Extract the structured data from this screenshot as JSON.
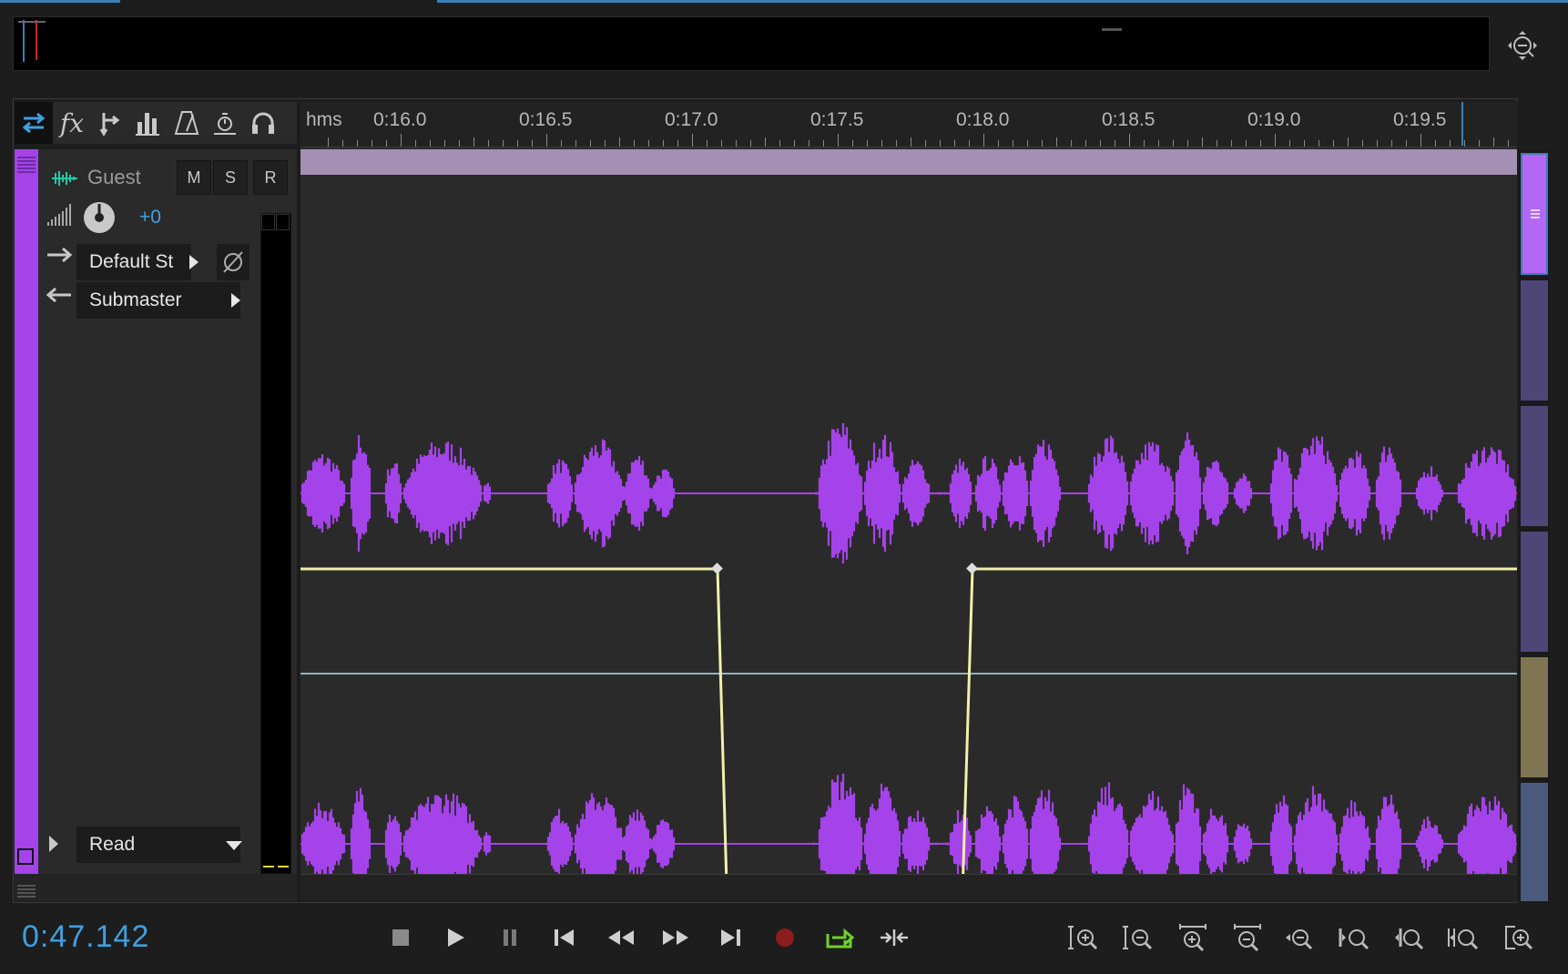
{
  "colors": {
    "track": "#a543ea",
    "accent_blue": "#3fa0e0",
    "envelope": "#f2f0a8",
    "clip_bar": "#a48fb5",
    "waveform": "#a543ea",
    "center_line": "#e0307a",
    "record": "#8b1d1d",
    "loop": "#6fd12b"
  },
  "ruler": {
    "unit": "hms",
    "labels": [
      "0:16.0",
      "0:16.5",
      "0:17.0",
      "0:17.5",
      "0:18.0",
      "0:18.5",
      "0:19.0",
      "0:19.5"
    ]
  },
  "toolbar": {
    "icons": [
      "inputs-outputs-icon",
      "fx-icon",
      "sends-icon",
      "eq-icon",
      "metronome-icon",
      "stretch-icon",
      "headphones-icon"
    ]
  },
  "track": {
    "name": "Guest",
    "mute_label": "M",
    "solo_label": "S",
    "record_label": "R",
    "volume": "+0",
    "input": "Default St",
    "output": "Submaster",
    "automation_mode": "Read"
  },
  "transport": {
    "time": "0:47.142",
    "buttons": [
      "stop-icon",
      "play-icon",
      "pause-icon",
      "go-to-start-icon",
      "rewind-icon",
      "fast-forward-icon",
      "go-to-end-icon",
      "record-icon",
      "loop-icon",
      "skip-selection-icon"
    ]
  },
  "zoom": {
    "buttons": [
      "zoom-in-amplitude-icon",
      "zoom-out-amplitude-icon",
      "zoom-in-time-icon",
      "zoom-out-time-icon",
      "zoom-out-full-icon",
      "zoom-in-at-start-icon",
      "zoom-in-at-end-icon",
      "zoom-to-selection-icon",
      "zoom-selected-tracks-icon"
    ]
  }
}
